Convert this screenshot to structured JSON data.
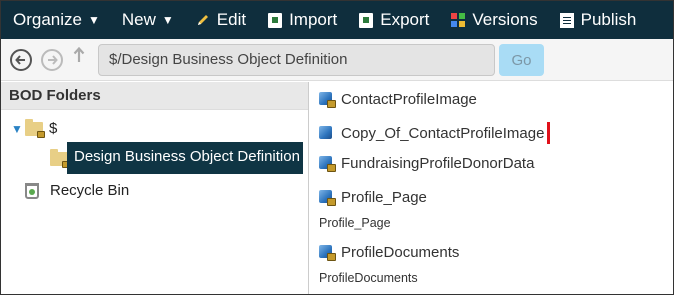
{
  "toolbar": {
    "organize": "Organize",
    "new": "New",
    "edit": "Edit",
    "import": "Import",
    "export": "Export",
    "versions": "Versions",
    "publish": "Publish",
    "caret": "▼"
  },
  "nav": {
    "back_icon": "arrow-left-circle-icon",
    "forward_icon": "arrow-right-circle-icon",
    "up_icon": "arrow-up-icon",
    "path": "$/Design Business Object Definition",
    "go": "Go"
  },
  "left_pane": {
    "header": "BOD Folders",
    "root_label": "$",
    "selected_folder": "Design Business Object Definition",
    "recycle_bin": "Recycle Bin"
  },
  "items": [
    {
      "label": "ContactProfileImage",
      "subtitle": ""
    },
    {
      "label": "Copy_Of_ContactProfileImage",
      "subtitle": ""
    },
    {
      "label": "FundraisingProfileDonorData",
      "subtitle": ""
    },
    {
      "label": "Profile_Page",
      "subtitle": "Profile_Page"
    },
    {
      "label": "ProfileDocuments",
      "subtitle": "ProfileDocuments"
    }
  ],
  "colors": {
    "toolbar_bg": "#0f2e3d",
    "selected_bg": "#0f3544",
    "go_bg": "#a9dcf5",
    "cursor": "#e0111a"
  }
}
